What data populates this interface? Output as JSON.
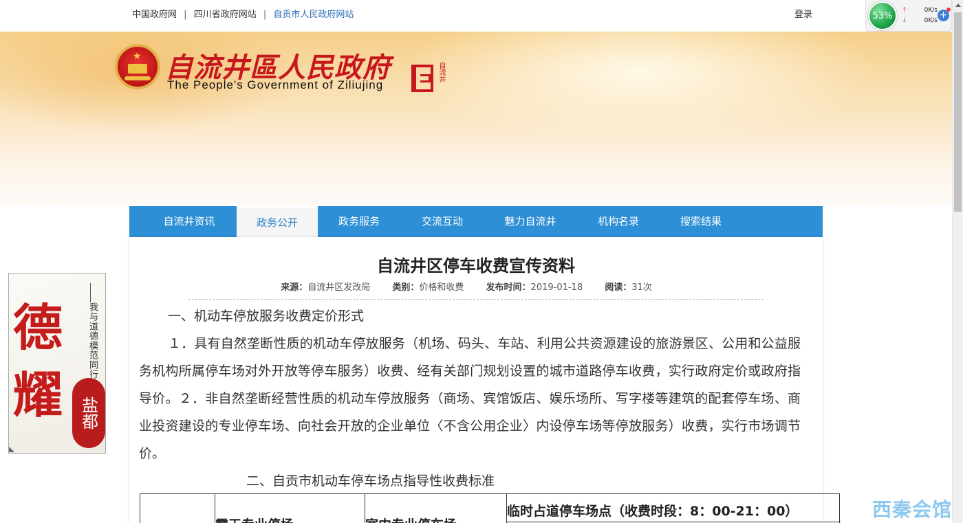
{
  "top_links": {
    "link1": "中国政府网",
    "link2": "四川省政府网站",
    "link3": "自贡市人民政府网站",
    "sep": "|",
    "login": "登录"
  },
  "net_widget": {
    "percent": "53%",
    "up_speed": "0K/s",
    "down_speed": "0K/s",
    "up_arrow": "↑",
    "down_arrow": "↓",
    "plus": "+"
  },
  "banner": {
    "title_cn": "自流井區人民政府",
    "title_en": "The People's Government of Ziliujing",
    "seal_text": "自流井"
  },
  "nav": {
    "items": [
      {
        "label": "自流井资讯"
      },
      {
        "label": "政务公开"
      },
      {
        "label": "政务服务"
      },
      {
        "label": "交流互动"
      },
      {
        "label": "魅力自流井"
      },
      {
        "label": "机构名录"
      },
      {
        "label": "搜索结果"
      }
    ],
    "active_index": 1
  },
  "article": {
    "title": "自流井区停车收费宣传资料",
    "source_label": "来源：",
    "source": "自流井区发改局",
    "category_label": "类别：",
    "category": "价格和收费",
    "date_label": "发布时间：",
    "date": "2019-01-18",
    "reads_label": "阅读：",
    "reads": "31次",
    "heading1": "一、机动车停放服务收费定价形式",
    "body1": "１．具有自然垄断性质的机动车停放服务（机场、码头、车站、利用公共资源建设的旅游景区、公用和公益服务机构所属停车场对外开放等停车服务）收费、经有关部门规划设置的城市道路停车收费，实行政府定价或政府指导价。２．非自然垄断经营性质的机动车停放服务（商场、宾馆饭店、娱乐场所、写字楼等建筑的配套停车场、商业投资建设的专业停车场、向社会开放的企业单位〈不含公用企业〉内设停车场等停放服务）收费，实行市场调节价。",
    "heading2": "二、自贡市机动车停车场点指导性收费标准"
  },
  "table": {
    "col1": "",
    "col2": "露天专业停场",
    "col3": "室内专业停车场",
    "col4": "临时占道停车场点（收费时段：8：00-21：00）"
  },
  "side_ad": {
    "char1": "德",
    "char2": "耀",
    "slogan": "我与道德模范同行",
    "stamp": "盐都"
  },
  "watermark": "西秦会馆",
  "colors": {
    "nav_bg": "#2d8fd6",
    "brand_red": "#c8161d",
    "link_blue": "#2b6cb8"
  }
}
